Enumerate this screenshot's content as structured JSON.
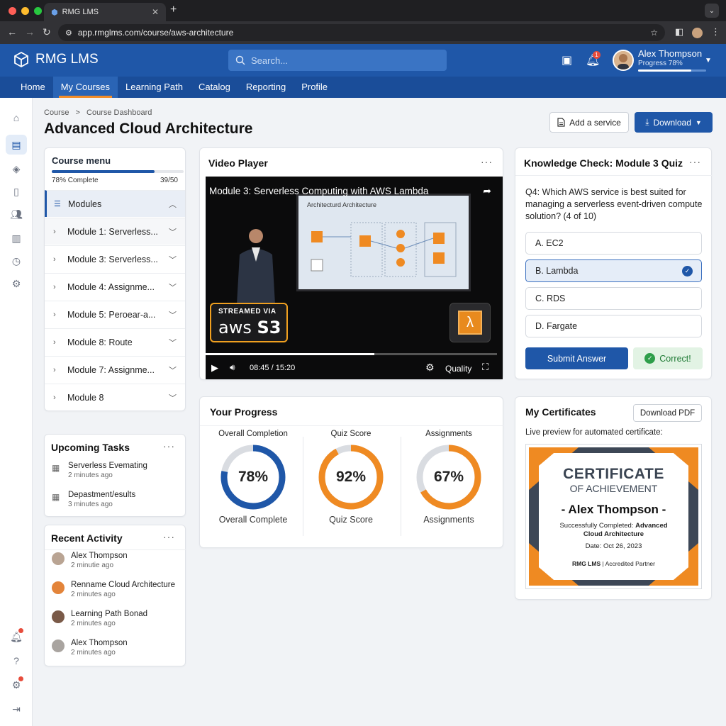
{
  "browser": {
    "tab_title": "RMG LMS",
    "url": "app.rmglms.com/course/aws-architecture"
  },
  "app": {
    "brand": "RMG LMS",
    "search_placeholder": "Search...",
    "notif_count": "1",
    "user_name": "Alex Thompson",
    "user_progress_label": "Progress 78%",
    "user_progress": 0.78
  },
  "nav": [
    "Home",
    "My Courses",
    "Learning Path",
    "Catalog",
    "Reporting",
    "Profile"
  ],
  "nav_active": "My Courses",
  "rail_icons": [
    "home-icon",
    "book-icon",
    "layers-icon",
    "open-book-icon",
    "users-icon",
    "chart-icon",
    "clock-icon",
    "gear-icon",
    "bell-icon",
    "help-icon",
    "settings-icon",
    "logout-icon"
  ],
  "breadcrumb": {
    "root": "Course",
    "sep": ">",
    "current": "Course Dashboard"
  },
  "page_title": "Advanced Cloud Architecture",
  "actions": {
    "add_service": "Add a service",
    "download": "Download"
  },
  "course_menu": {
    "title": "Course menu",
    "complete_label": "78% Complete",
    "complete": 0.78,
    "count": "39/50",
    "section": "Modules",
    "modules": [
      "Module 1: Serverless...",
      "Module 3: Serverless...",
      "Module 4: Assignme...",
      "Module 5: Peroear-a...",
      "Module 8: Route",
      "Module 7: Assignme...",
      "Module 8"
    ]
  },
  "video": {
    "card_title": "Video Player",
    "title": "Module 3: Serverless Computing with AWS Lambda",
    "slide_title": "Architecturd Architecture",
    "badge_top": "STREAMED VIA",
    "badge_aws": "aws",
    "badge_s3": "S3",
    "time": "08:45 / 15:20",
    "played": 0.58,
    "quality": "Quality"
  },
  "quiz": {
    "title": "Knowledge Check: Module 3 Quiz",
    "question": "Q4: Which AWS service is best suited for managing a serverless event-driven compute solution? (4 of 10)",
    "options": [
      "A.  EC2",
      "B.  Lambda",
      "C.  RDS",
      "D.  Fargate"
    ],
    "selected": 1,
    "submit": "Submit Answer",
    "result": "Correct!"
  },
  "progress": {
    "title": "Your Progress",
    "items": [
      {
        "label": "Overall Completion",
        "value": 78,
        "display": "78%",
        "sub": "Overall Complete",
        "color": "#1f57a8"
      },
      {
        "label": "Quiz Score",
        "value": 92,
        "display": "92%",
        "sub": "Quiz Score",
        "color": "#ef8a22"
      },
      {
        "label": "Assignments",
        "value": 67,
        "display": "67%",
        "sub": "Assignments",
        "color": "#ef8a22"
      }
    ]
  },
  "certificates": {
    "title": "My Certificates",
    "download": "Download PDF",
    "caption": "Live preview for automated certificate:",
    "cert_title": "CERTIFICATE",
    "cert_sub": "OF ACHIEVEMENT",
    "cert_name": "- Alex Thompson -",
    "cert_completed_prefix": "Successfully Completed: ",
    "cert_course": "Advanced Cloud Architecture",
    "cert_date": "Date: Oct 26, 2023",
    "cert_brand": "RMG LMS",
    "cert_partner": "Accredited Partner"
  },
  "tasks": {
    "title": "Upcoming Tasks",
    "items": [
      {
        "name": "Serverless Evemating",
        "time": "2 minutes ago"
      },
      {
        "name": "Depastment/esults",
        "time": "3 minutes ago"
      }
    ]
  },
  "activity": {
    "title": "Recent Activity",
    "items": [
      {
        "name": "Alex Thompson",
        "time": "2 minutie ago"
      },
      {
        "name": "Renname Cloud Architecture",
        "time": "2 minutes ago"
      },
      {
        "name": "Learning Path Bonad",
        "time": "2 minutes ago"
      },
      {
        "name": "Alex Thompson",
        "time": "2 minutes ago"
      }
    ]
  }
}
